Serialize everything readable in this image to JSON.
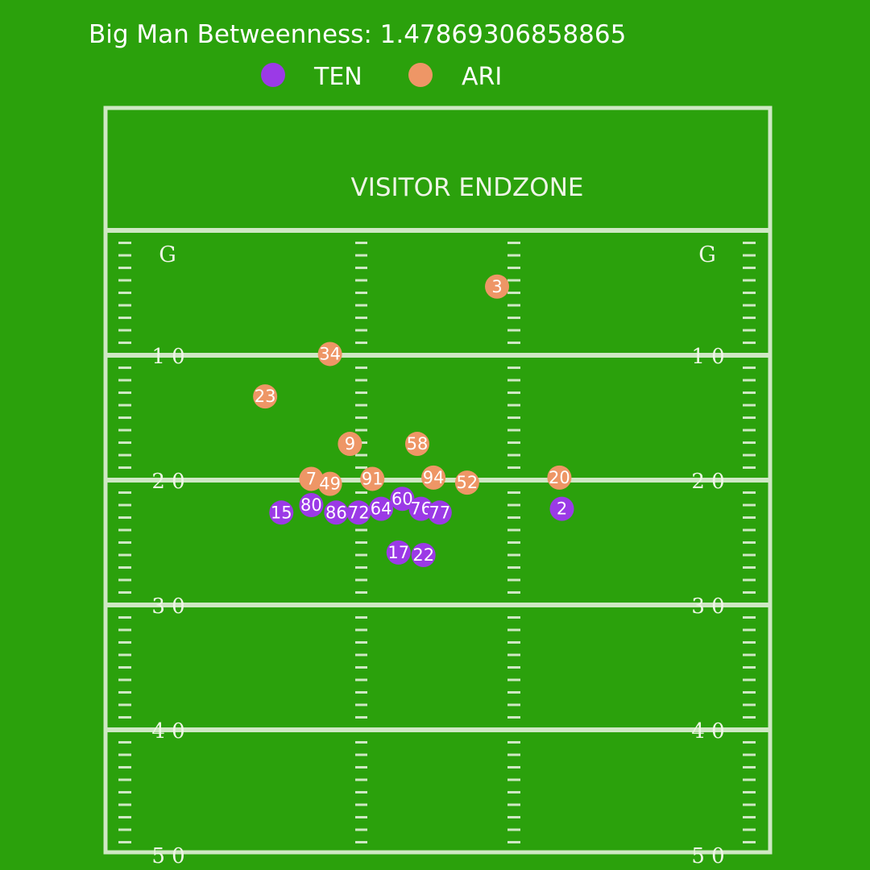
{
  "chart_data": {
    "type": "scatter",
    "title": "Big Man Betweenness: 1.47869306858865",
    "legend": {
      "placement": "top-center",
      "entries": [
        {
          "name": "TEN",
          "color": "#9b3ae6"
        },
        {
          "name": "ARI",
          "color": "#ee9666"
        }
      ]
    },
    "field": {
      "background": "#2ba10c",
      "line_color": "#cfe8c4",
      "endzone_label": "VISITOR ENDZONE",
      "goal_labels": [
        "G",
        "G"
      ],
      "yard_lines": [
        {
          "yard": 10,
          "label": "1 0"
        },
        {
          "yard": 20,
          "label": "2 0"
        },
        {
          "yard": 30,
          "label": "3 0"
        },
        {
          "yard": 40,
          "label": "4 0"
        },
        {
          "yard": 50,
          "label": "5 0"
        }
      ],
      "xlim": [
        0,
        53.3
      ],
      "ylim": [
        -10,
        50
      ],
      "grid": false
    },
    "series": [
      {
        "name": "TEN",
        "color": "#9b3ae6",
        "points": [
          {
            "jersey": "15",
            "x": 14.1,
            "y": 22.6
          },
          {
            "jersey": "80",
            "x": 16.5,
            "y": 22.0
          },
          {
            "jersey": "86",
            "x": 18.5,
            "y": 22.6
          },
          {
            "jersey": "72",
            "x": 20.3,
            "y": 22.6
          },
          {
            "jersey": "64",
            "x": 22.1,
            "y": 22.3
          },
          {
            "jersey": "60",
            "x": 23.8,
            "y": 21.5
          },
          {
            "jersey": "76",
            "x": 25.3,
            "y": 22.3
          },
          {
            "jersey": "77",
            "x": 26.8,
            "y": 22.6
          },
          {
            "jersey": "17",
            "x": 23.5,
            "y": 25.8
          },
          {
            "jersey": "22",
            "x": 25.5,
            "y": 26.0
          },
          {
            "jersey": "2",
            "x": 36.6,
            "y": 22.3
          }
        ]
      },
      {
        "name": "ARI",
        "color": "#ee9666",
        "points": [
          {
            "jersey": "3",
            "x": 31.4,
            "y": 4.5
          },
          {
            "jersey": "34",
            "x": 18.0,
            "y": 9.9
          },
          {
            "jersey": "23",
            "x": 12.8,
            "y": 13.3
          },
          {
            "jersey": "9",
            "x": 19.6,
            "y": 17.1
          },
          {
            "jersey": "58",
            "x": 25.0,
            "y": 17.1
          },
          {
            "jersey": "7",
            "x": 16.5,
            "y": 19.9
          },
          {
            "jersey": "49",
            "x": 18.0,
            "y": 20.3
          },
          {
            "jersey": "91",
            "x": 21.4,
            "y": 19.9
          },
          {
            "jersey": "94",
            "x": 26.3,
            "y": 19.8
          },
          {
            "jersey": "52",
            "x": 29.0,
            "y": 20.2
          },
          {
            "jersey": "20",
            "x": 36.4,
            "y": 19.8
          }
        ]
      }
    ]
  }
}
